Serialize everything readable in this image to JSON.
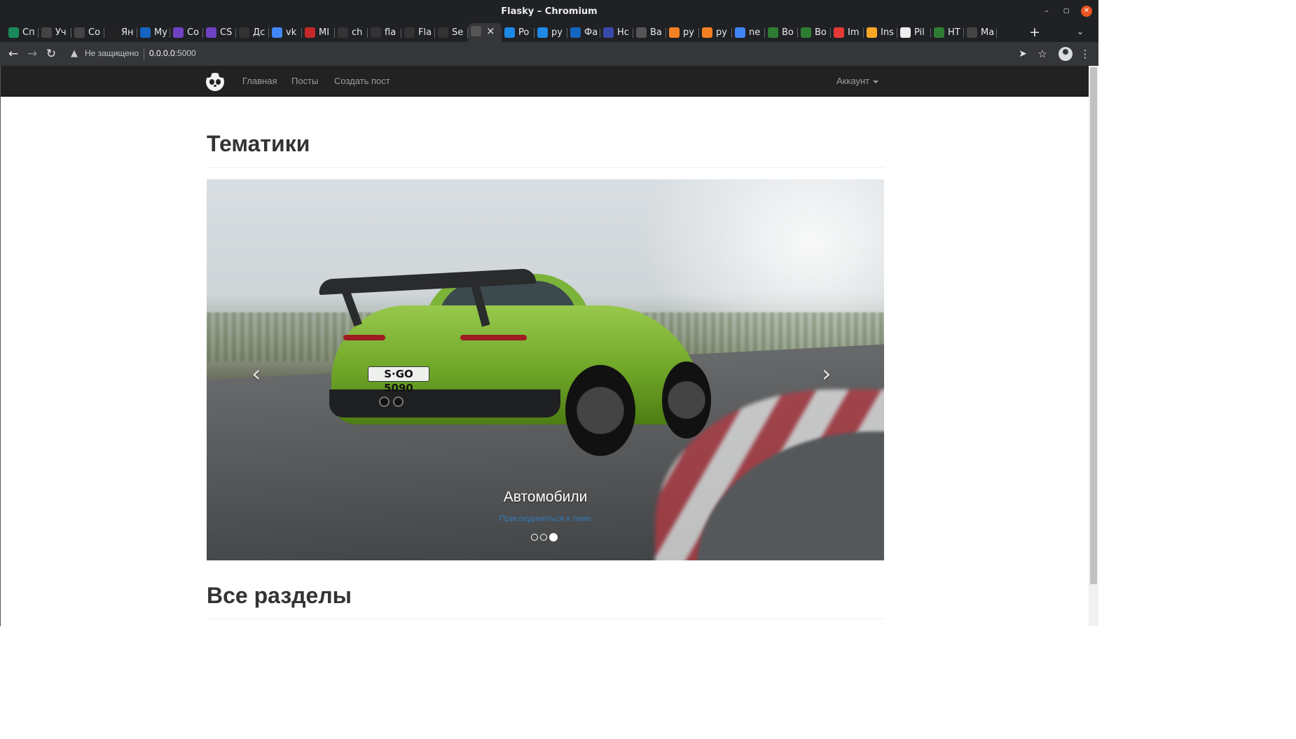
{
  "window": {
    "title": "Flasky – Chromium"
  },
  "tabs": [
    {
      "label": "Сп",
      "color": "#1a8a5a"
    },
    {
      "label": "Уч",
      "color": "#444"
    },
    {
      "label": "Co",
      "color": "#444"
    },
    {
      "label": "Ян",
      "color": "#222"
    },
    {
      "label": "My",
      "color": "#1565c0"
    },
    {
      "label": "Co",
      "color": "#6f42c1"
    },
    {
      "label": "CS",
      "color": "#6f42c1"
    },
    {
      "label": "Дс",
      "color": "#333"
    },
    {
      "label": "vk",
      "color": "#4285f4"
    },
    {
      "label": "MI",
      "color": "#c62828"
    },
    {
      "label": "ch",
      "color": "#333"
    },
    {
      "label": "fla",
      "color": "#333"
    },
    {
      "label": "Fla",
      "color": "#333"
    },
    {
      "label": "Se",
      "color": "#333"
    },
    {
      "label": "",
      "color": "#555",
      "active": true
    },
    {
      "label": "Po",
      "color": "#1e88e5"
    },
    {
      "label": "py",
      "color": "#1e88e5"
    },
    {
      "label": "Фа",
      "color": "#1565c0"
    },
    {
      "label": "Hc",
      "color": "#3949ab"
    },
    {
      "label": "Ba",
      "color": "#555"
    },
    {
      "label": "py",
      "color": "#f48024"
    },
    {
      "label": "py",
      "color": "#f48024"
    },
    {
      "label": "ne",
      "color": "#4285f4"
    },
    {
      "label": "Bo",
      "color": "#2e7d32"
    },
    {
      "label": "Bo",
      "color": "#2e7d32"
    },
    {
      "label": "Im",
      "color": "#e53935"
    },
    {
      "label": "Ins",
      "color": "#f9a825"
    },
    {
      "label": "Pil",
      "color": "#eee"
    },
    {
      "label": "HT",
      "color": "#2e7d32"
    },
    {
      "label": "Ma",
      "color": "#444"
    }
  ],
  "toolbar": {
    "security": "Не защищено",
    "url_host": "0.0.0.0",
    "url_port": ":5000"
  },
  "navbar": {
    "home": "Главная",
    "posts": "Посты",
    "create": "Создать пост",
    "account": "Аккаунт"
  },
  "main": {
    "themes_heading": "Тематики",
    "carousel": {
      "plate_text": "S·GO 5090",
      "caption_title": "Автомобили",
      "caption_link": "Присоединиться к теме",
      "slides_count": 3,
      "active_slide": 3
    },
    "sections_heading": "Все разделы"
  }
}
